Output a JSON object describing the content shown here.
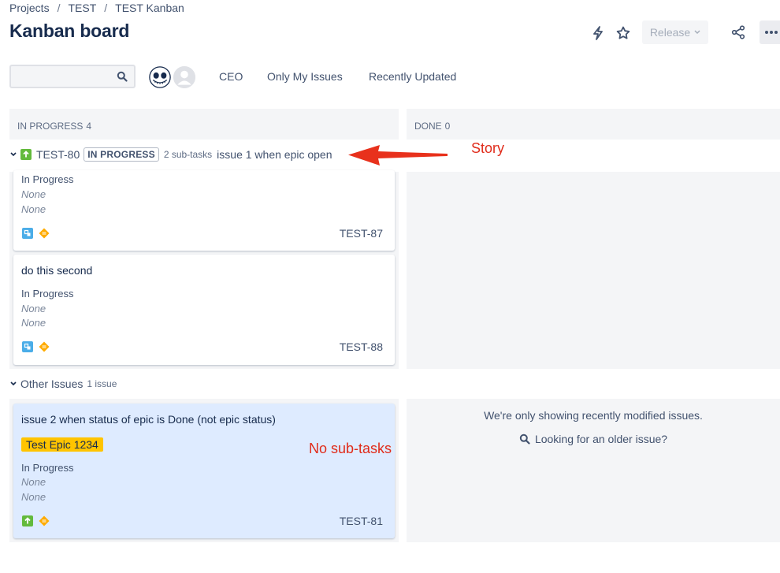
{
  "breadcrumb": {
    "items": [
      "Projects",
      "TEST",
      "TEST Kanban"
    ],
    "separator": "/"
  },
  "page": {
    "title": "Kanban board"
  },
  "header_actions": {
    "release_label": "Release"
  },
  "filters": {
    "search": {
      "value": "",
      "placeholder": ""
    },
    "quick_filters": [
      "CEO",
      "Only My Issues",
      "Recently Updated"
    ]
  },
  "columns": [
    {
      "name": "IN PROGRESS",
      "count": "4"
    },
    {
      "name": "DONE",
      "count": "0"
    }
  ],
  "swimlanes": {
    "story": {
      "key": "TEST-80",
      "status": "IN PROGRESS",
      "subtasks": "2 sub-tasks",
      "summary": "issue 1 when epic open"
    },
    "other": {
      "label": "Other Issues",
      "count": "1 issue"
    }
  },
  "cards": [
    {
      "summary": "",
      "status": "In Progress",
      "field1": "None",
      "field2": "None",
      "key": "TEST-87"
    },
    {
      "summary": "do this second",
      "status": "In Progress",
      "field1": "None",
      "field2": "None",
      "key": "TEST-88"
    },
    {
      "summary": "issue 2 when status of epic is Done (not epic status)",
      "epic": "Test Epic 1234",
      "status": "In Progress",
      "field1": "None",
      "field2": "None",
      "key": "TEST-81"
    }
  ],
  "done_column": {
    "message": "We're only showing recently modified issues.",
    "link": "Looking for an older issue?"
  },
  "annotations": {
    "story": "Story",
    "no_subtasks": "No sub-tasks"
  },
  "colors": {
    "accent": "#0052cc",
    "story_green": "#63ba3c",
    "subtask_blue": "#4bade8",
    "priority_yellow": "#ffab00",
    "epic_yellow": "#ffc400",
    "annotation_red": "#e02b1a",
    "highlight_card": "#deebff"
  },
  "icons": [
    "search-icon",
    "lightning-icon",
    "star-icon",
    "share-icon",
    "more-icon",
    "chevron-down-icon",
    "story-icon",
    "subtask-icon",
    "priority-medium-icon"
  ]
}
